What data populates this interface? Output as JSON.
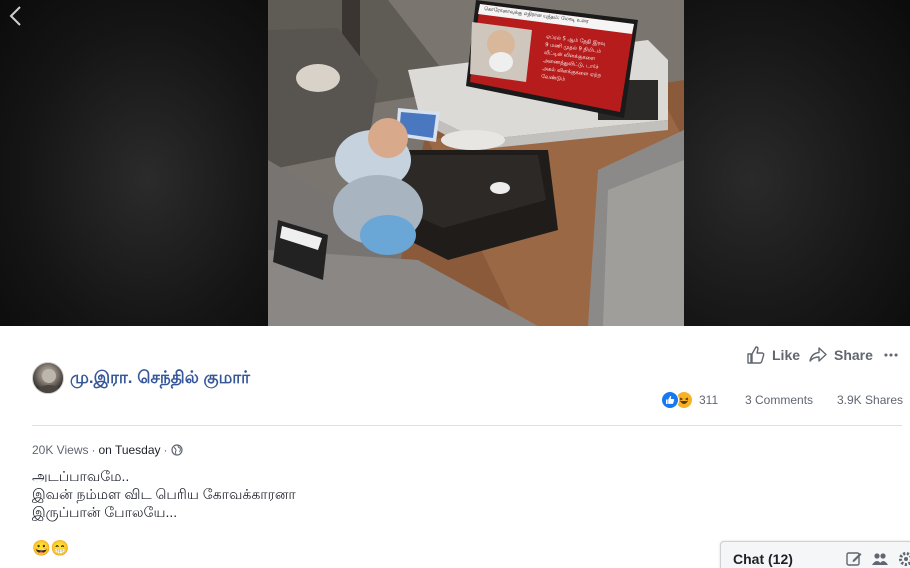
{
  "video": {
    "tv_headline": "கொரோனாவுக்கு எதிரான யுத்தம்: மோடி உரை",
    "tv_caption_lines": [
      "ஏப்ரல் 5 ஆம் தேதி இரவு",
      "9 மணி முதல் 9 நிமிடம்",
      "வீட்டின் விளக்குகளை",
      "அணைத்துவிட்டு, டார்ச்",
      "அகல் விளக்குகளை ஏற்ற",
      "வேண்டும்"
    ]
  },
  "post": {
    "author": "மு.இரா. செந்தில் குமார்",
    "actions": {
      "like": "Like",
      "share": "Share"
    },
    "stats": {
      "reactions_count": "311",
      "comments": "3 Comments",
      "shares": "3.9K Shares"
    },
    "meta": {
      "views": "20K Views",
      "separator": "·",
      "date": "on Tuesday"
    },
    "text_lines": [
      "அடப்பாவமே..",
      "இவன் நம்மள விட பெரிய கோவக்காரனா",
      "இருப்பான் போலயே..."
    ],
    "emojis": "😀😁"
  },
  "chat": {
    "label": "Chat (12)"
  },
  "colors": {
    "link_blue": "#365899",
    "secondary_text": "#606770",
    "like_blue": "#1877f2",
    "haha_yellow": "#f7b125"
  }
}
